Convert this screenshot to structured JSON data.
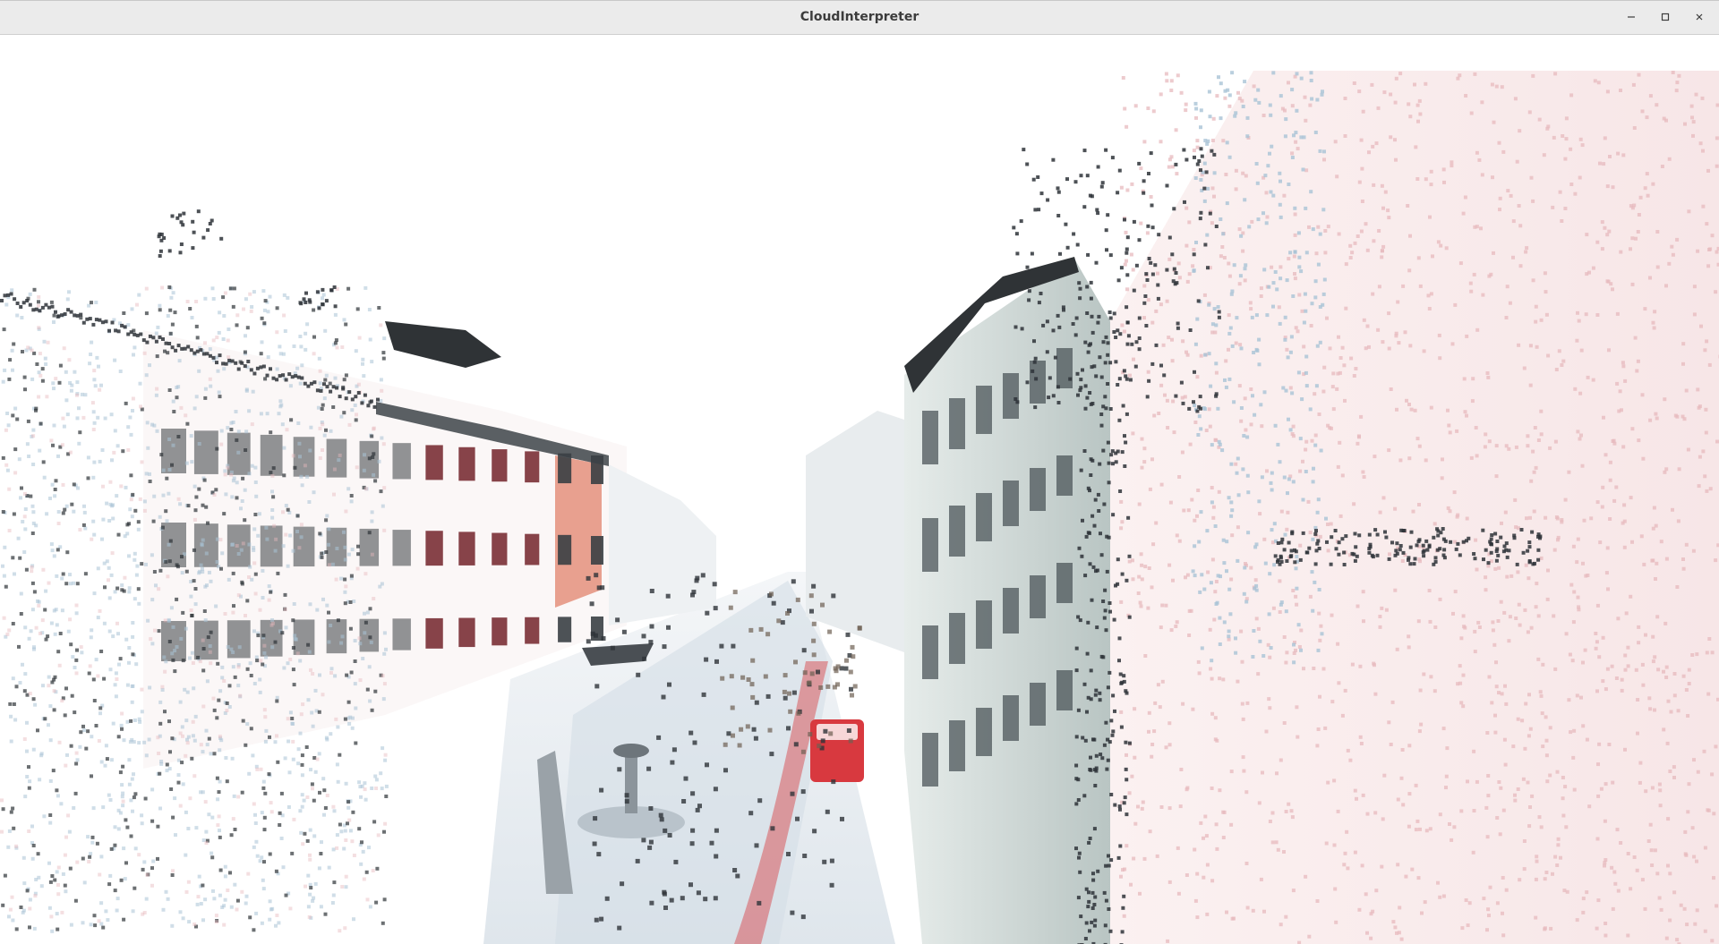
{
  "window": {
    "title": "CloudInterpreter",
    "controls": [
      {
        "name": "minimize-icon"
      },
      {
        "name": "maximize-icon"
      },
      {
        "name": "close-icon"
      }
    ]
  },
  "viewport": {
    "content": "point-cloud-scene",
    "background": "#ffffff",
    "palette": {
      "dark_points": "#2e3338",
      "blue_points": "#a9c3d6",
      "pink_points": "#e7b9bd",
      "facade_left": "#f3eeee",
      "facade_right": "#cfd8d6",
      "roof": "#333638",
      "red_vehicle": "#d8393f",
      "street": "#e9edf1"
    }
  }
}
